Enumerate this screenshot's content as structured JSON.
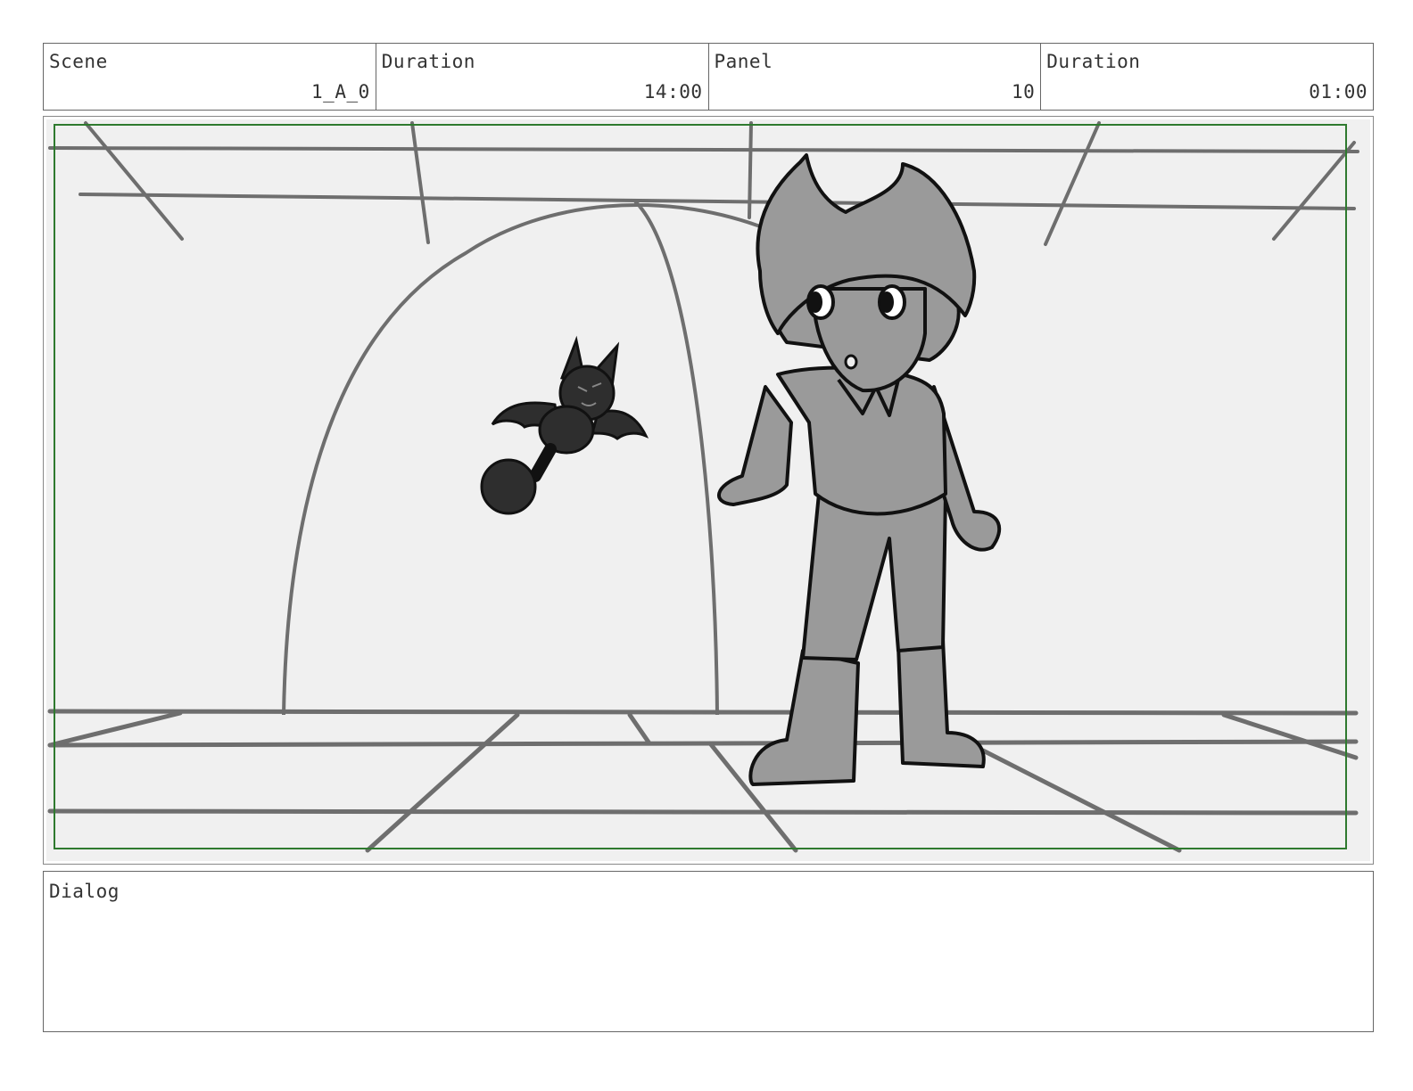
{
  "header": {
    "scene": {
      "label": "Scene",
      "value": "1_A_0"
    },
    "scene_duration": {
      "label": "Duration",
      "value": "14:00"
    },
    "panel": {
      "label": "Panel",
      "value": "10"
    },
    "panel_duration": {
      "label": "Duration",
      "value": "01:00"
    }
  },
  "dialog": {
    "label": "Dialog",
    "text": ""
  },
  "colors": {
    "safe_area": "#2f7a2f",
    "background": "#f0f0f0",
    "sketch_line": "#6e6e6e",
    "character_fill": "#9a9a9a",
    "bat_fill": "#2e2e2e"
  }
}
